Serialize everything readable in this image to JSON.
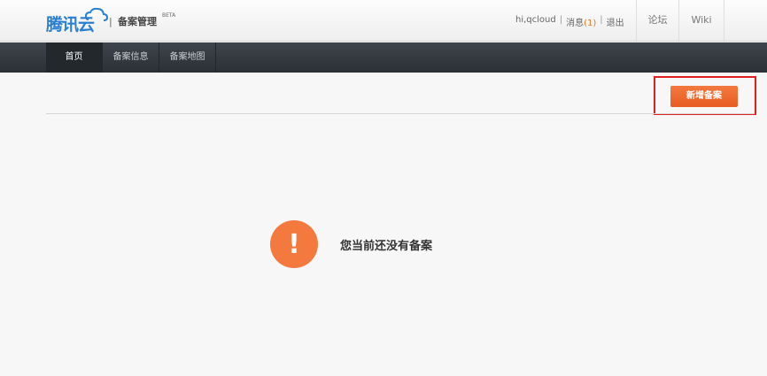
{
  "header": {
    "logo_text": "腾讯云",
    "separator": "|",
    "app_title": "备案管理",
    "beta": "BETA",
    "user": "hi,qcloud",
    "messages_label": "消息",
    "messages_count": "(1)",
    "logout": "退出",
    "forum": "论坛",
    "wiki": "Wiki",
    "divider": "|"
  },
  "nav": {
    "items": [
      {
        "label": "首页",
        "active": true
      },
      {
        "label": "备案信息",
        "active": false
      },
      {
        "label": "备案地图",
        "active": false
      }
    ]
  },
  "toolbar": {
    "new_filing_label": "新增备案"
  },
  "empty_state": {
    "icon": "!",
    "message": "您当前还没有备案"
  },
  "colors": {
    "accent": "#f3793f",
    "highlight": "#e02020",
    "brand": "#2a7fd0"
  }
}
